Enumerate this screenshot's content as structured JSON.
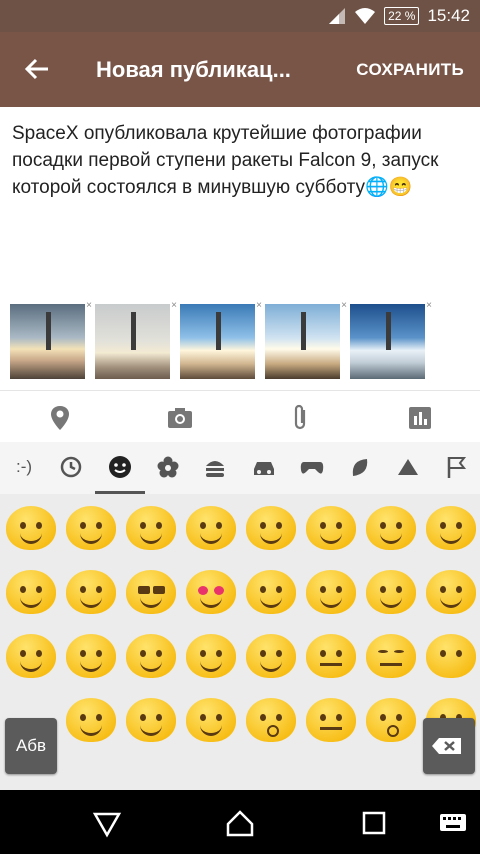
{
  "status": {
    "battery": "22 %",
    "time": "15:42"
  },
  "toolbar": {
    "title": "Новая публикац...",
    "save_label": "СОХРАНИТЬ"
  },
  "post": {
    "text": "SpaceX опубликовала крутейшие фотографии посадки первой ступени ракеты Falcon 9, запуск которой состоялся в минувшую субботу🌐😁"
  },
  "thumbnails": [
    "remove-x",
    "remove-x",
    "remove-x",
    "remove-x",
    "remove-x"
  ],
  "thumb_close": "×",
  "emoji_tabs": {
    "emoticon_label": ":-)"
  },
  "keyboard": {
    "abc_label": "Абв"
  },
  "colors": {
    "statusbar": "#6d5245",
    "toolbar": "#795548",
    "emoji_bg": "#ececec"
  }
}
